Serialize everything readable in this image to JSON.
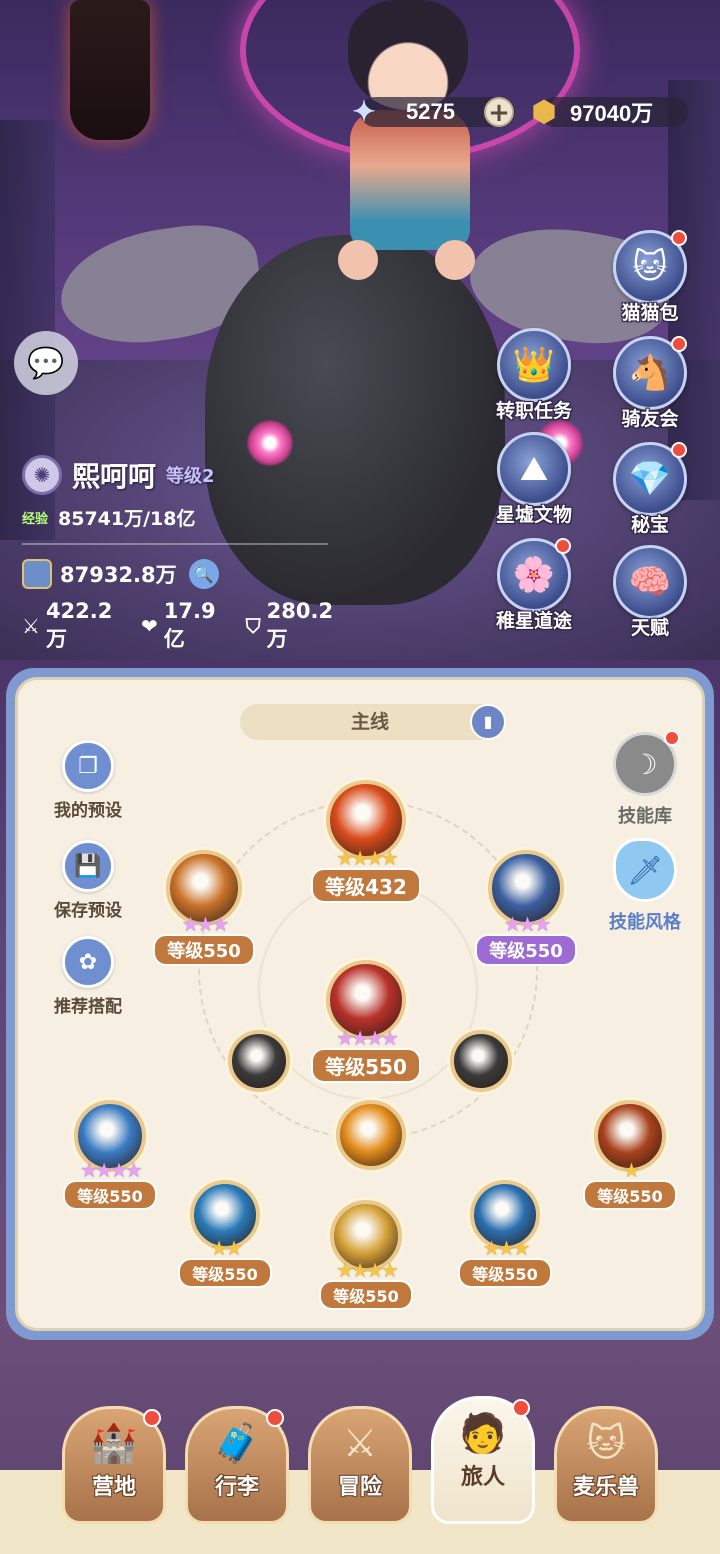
{
  "currency": {
    "stars": "5275",
    "gold": "97040万",
    "plus_label": "+"
  },
  "side_right": [
    {
      "label": "猫猫包",
      "icon": "cat-bag-icon",
      "glyph": "🐱",
      "badge": true
    },
    {
      "label": "骑友会",
      "icon": "horse-icon",
      "glyph": "🐴",
      "badge": true
    },
    {
      "label": "秘宝",
      "icon": "treasure-icon",
      "glyph": "💎",
      "badge": true
    },
    {
      "label": "天赋",
      "icon": "talent-icon",
      "glyph": "🧠",
      "badge": false
    }
  ],
  "side_mid": [
    {
      "label": "转职任务",
      "icon": "class-change-icon",
      "glyph": "👑",
      "badge": false
    },
    {
      "label": "星墟文物",
      "icon": "relic-icon",
      "glyph": "⛰",
      "badge": false
    },
    {
      "label": "稚星道途",
      "icon": "path-icon",
      "glyph": "🌸",
      "badge": true
    }
  ],
  "player": {
    "name": "熙呵呵",
    "level": "等级2",
    "exp_tag": "经验",
    "exp": "85741万/18亿",
    "power": "87932.8万",
    "attack": "422.2万",
    "hp": "17.9亿",
    "defense": "280.2万"
  },
  "panel": {
    "tab_title": "主线",
    "left_buttons": [
      "我的预设",
      "保存预设",
      "推荐搭配"
    ],
    "right_buttons": [
      {
        "label": "技能库",
        "color": "#6a6a6a"
      },
      {
        "label": "技能风格",
        "color": "#5b7fc7"
      }
    ]
  },
  "skills": [
    {
      "level": "等级432",
      "stars": "★★★★",
      "color": "#d94c1c",
      "star_type": "gold",
      "badge": "orange"
    },
    {
      "level": "等级550",
      "stars": "★★★",
      "color": "#c9722a",
      "star_type": "pink",
      "badge": "orange"
    },
    {
      "level": "等级550",
      "stars": "★★★",
      "color": "#3a5fa0",
      "star_type": "pink",
      "badge": "purple"
    },
    {
      "level": "等级550",
      "stars": "★★★★",
      "color": "#b8322a",
      "star_type": "pink",
      "badge": "orange"
    },
    {
      "level": "",
      "stars": "",
      "color": "#3a3a3a",
      "star_type": "gold",
      "badge": "none"
    },
    {
      "level": "",
      "stars": "",
      "color": "#3a3a3a",
      "star_type": "gold",
      "badge": "none"
    },
    {
      "level": "",
      "stars": "",
      "color": "#e38c1c",
      "star_type": "gold",
      "badge": "none"
    },
    {
      "level": "等级550",
      "stars": "★★★★",
      "color": "#3a7bc4",
      "star_type": "pink",
      "badge": "orange"
    },
    {
      "level": "等级550",
      "stars": "★",
      "color": "#a8421c",
      "star_type": "gold",
      "badge": "orange"
    },
    {
      "level": "等级550",
      "stars": "★★",
      "color": "#2a7bb8",
      "star_type": "gold",
      "badge": "orange"
    },
    {
      "level": "等级550",
      "stars": "★★★★",
      "color": "#d6a23a",
      "star_type": "gold",
      "badge": "orange"
    },
    {
      "level": "等级550",
      "stars": "★★★",
      "color": "#2a6fb0",
      "star_type": "gold",
      "badge": "orange"
    }
  ],
  "nav": [
    {
      "label": "营地",
      "icon": "castle-icon",
      "glyph": "🏰",
      "badge": true,
      "active": false
    },
    {
      "label": "行李",
      "icon": "luggage-icon",
      "glyph": "🧳",
      "badge": true,
      "active": false
    },
    {
      "label": "冒险",
      "icon": "swords-icon",
      "glyph": "⚔",
      "badge": false,
      "active": false
    },
    {
      "label": "旅人",
      "icon": "traveler-icon",
      "glyph": "🧑",
      "badge": true,
      "active": true
    },
    {
      "label": "麦乐兽",
      "icon": "beast-icon",
      "glyph": "🐱",
      "badge": false,
      "active": false
    }
  ]
}
